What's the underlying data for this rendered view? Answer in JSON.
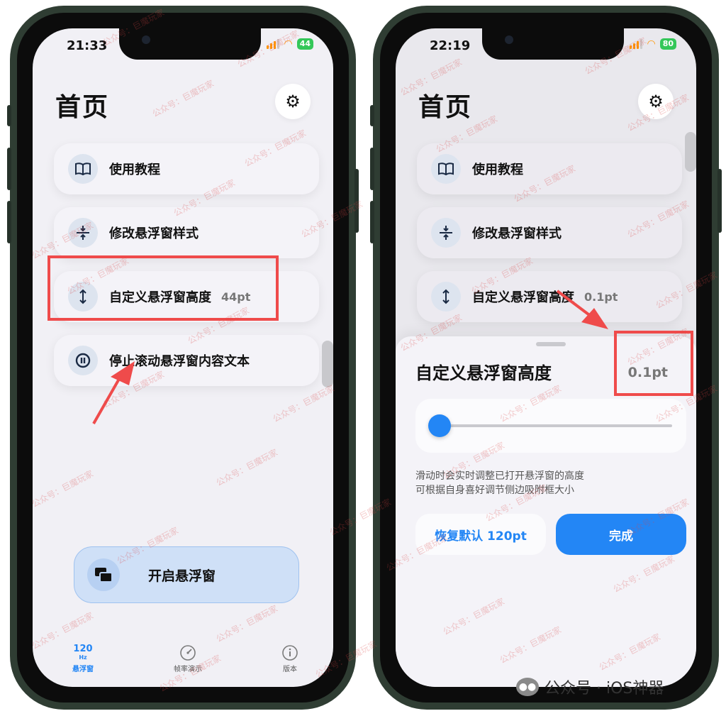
{
  "left": {
    "status_time": "21:33",
    "battery": "44",
    "page_title": "首页",
    "menu": [
      {
        "icon": "book-icon",
        "label": "使用教程",
        "value": ""
      },
      {
        "icon": "compress-icon",
        "label": "修改悬浮窗样式",
        "value": ""
      },
      {
        "icon": "vertical-resize-icon",
        "label": "自定义悬浮窗高度",
        "value": "44pt"
      },
      {
        "icon": "pause-icon",
        "label": "停止滚动悬浮窗内容文本",
        "value": ""
      }
    ],
    "start_button": "开启悬浮窗",
    "tabs": [
      {
        "label": "悬浮窗",
        "icon_text": "120",
        "sub": "Hz",
        "active": true
      },
      {
        "label": "帧率演示",
        "icon": "speedometer-icon",
        "active": false
      },
      {
        "label": "版本",
        "icon": "info-icon",
        "active": false
      }
    ]
  },
  "right": {
    "status_time": "22:19",
    "battery": "80",
    "page_title": "首页",
    "menu": [
      {
        "icon": "book-icon",
        "label": "使用教程",
        "value": ""
      },
      {
        "icon": "compress-icon",
        "label": "修改悬浮窗样式",
        "value": ""
      },
      {
        "icon": "vertical-resize-icon",
        "label": "自定义悬浮窗高度",
        "value": "0.1pt"
      }
    ],
    "sheet": {
      "title": "自定义悬浮窗高度",
      "value": "0.1pt",
      "slider_fraction": 0.0,
      "desc_line1": "滑动时会实时调整已打开悬浮窗的高度",
      "desc_line2": "可根据自身喜好调节侧边吸附框大小",
      "reset_button": "恢复默认 120pt",
      "done_button": "完成"
    }
  },
  "watermark": "公众号：巨魔玩家",
  "footer": {
    "text": "公众号 · iOS神器"
  },
  "colors": {
    "accent": "#2386f5",
    "highlight": "#ef4b4b",
    "frame": "#2f3d33"
  }
}
